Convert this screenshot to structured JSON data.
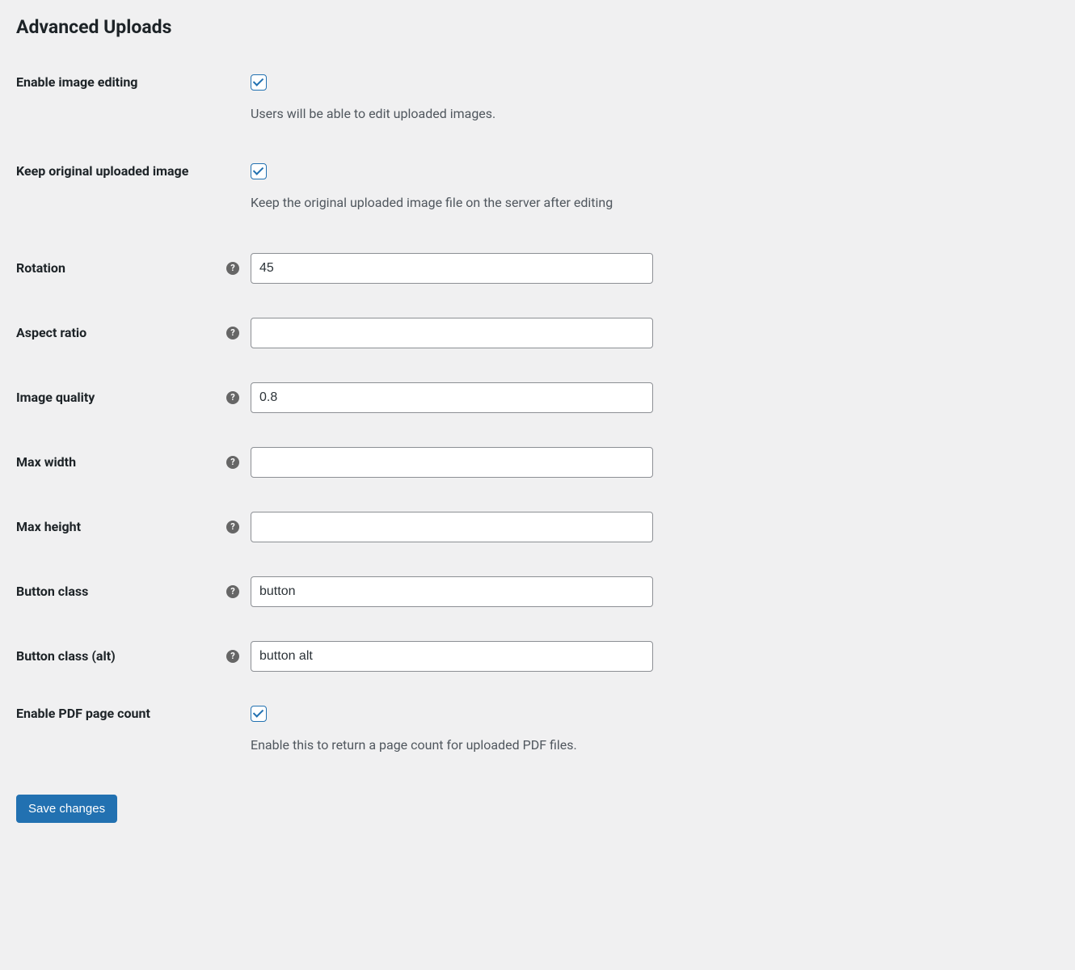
{
  "section": {
    "title": "Advanced Uploads"
  },
  "fields": {
    "enable_image_editing": {
      "label": "Enable image editing",
      "checked": true,
      "description": "Users will be able to edit uploaded images."
    },
    "keep_original": {
      "label": "Keep original uploaded image",
      "checked": true,
      "description": "Keep the original uploaded image file on the server after editing"
    },
    "rotation": {
      "label": "Rotation",
      "value": "45"
    },
    "aspect_ratio": {
      "label": "Aspect ratio",
      "value": ""
    },
    "image_quality": {
      "label": "Image quality",
      "value": "0.8"
    },
    "max_width": {
      "label": "Max width",
      "value": ""
    },
    "max_height": {
      "label": "Max height",
      "value": ""
    },
    "button_class": {
      "label": "Button class",
      "value": "button"
    },
    "button_class_alt": {
      "label": "Button class (alt)",
      "value": "button alt"
    },
    "enable_pdf_page_count": {
      "label": "Enable PDF page count",
      "checked": true,
      "description": "Enable this to return a page count for uploaded PDF files."
    }
  },
  "submit": {
    "label": "Save changes"
  }
}
